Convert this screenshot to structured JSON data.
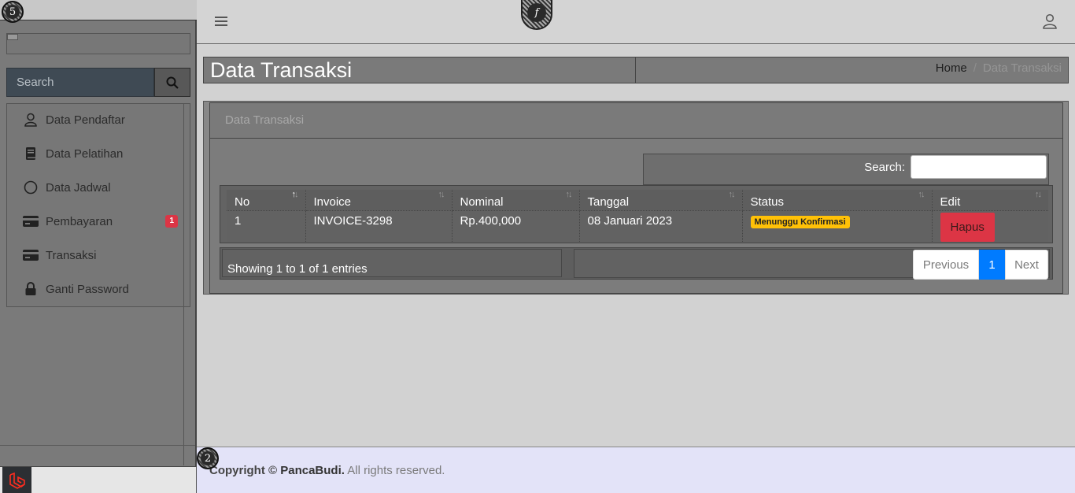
{
  "markers": {
    "top_left": "5",
    "footer": "2",
    "top_center": "f"
  },
  "sidebar": {
    "search_placeholder": "Search",
    "items": [
      {
        "label": "Data Pendaftar",
        "icon": "user-icon"
      },
      {
        "label": "Data Pelatihan",
        "icon": "book-icon"
      },
      {
        "label": "Data Jadwal",
        "icon": "circle-icon"
      },
      {
        "label": "Pembayaran",
        "icon": "credit-card-icon",
        "badge": "1"
      },
      {
        "label": "Transaksi",
        "icon": "credit-card-icon"
      },
      {
        "label": "Ganti Password",
        "icon": "lock-icon"
      }
    ]
  },
  "header": {
    "title": "Data Transaksi",
    "breadcrumb": {
      "home": "Home",
      "separator": "/",
      "current": "Data Transaksi"
    }
  },
  "card": {
    "title": "Data Transaksi",
    "search_label": "Search:",
    "columns": [
      "No",
      "Invoice",
      "Nominal",
      "Tanggal",
      "Status",
      "Edit"
    ],
    "rows": [
      {
        "no": "1",
        "invoice": "INVOICE-3298",
        "nominal": "Rp.400,000",
        "tanggal": "08 Januari 2023",
        "status": "Menunggu Konfirmasi",
        "action": "Hapus"
      }
    ],
    "info": "Showing 1 to 1 of 1 entries",
    "pagination": {
      "previous": "Previous",
      "current": "1",
      "next": "Next"
    }
  },
  "footer": {
    "prefix": "Copyright ©",
    "brand": "PancaBudi.",
    "suffix": "All rights reserved."
  },
  "colors": {
    "danger": "#dc3545",
    "warning": "#ffc107",
    "primary": "#007bff"
  }
}
